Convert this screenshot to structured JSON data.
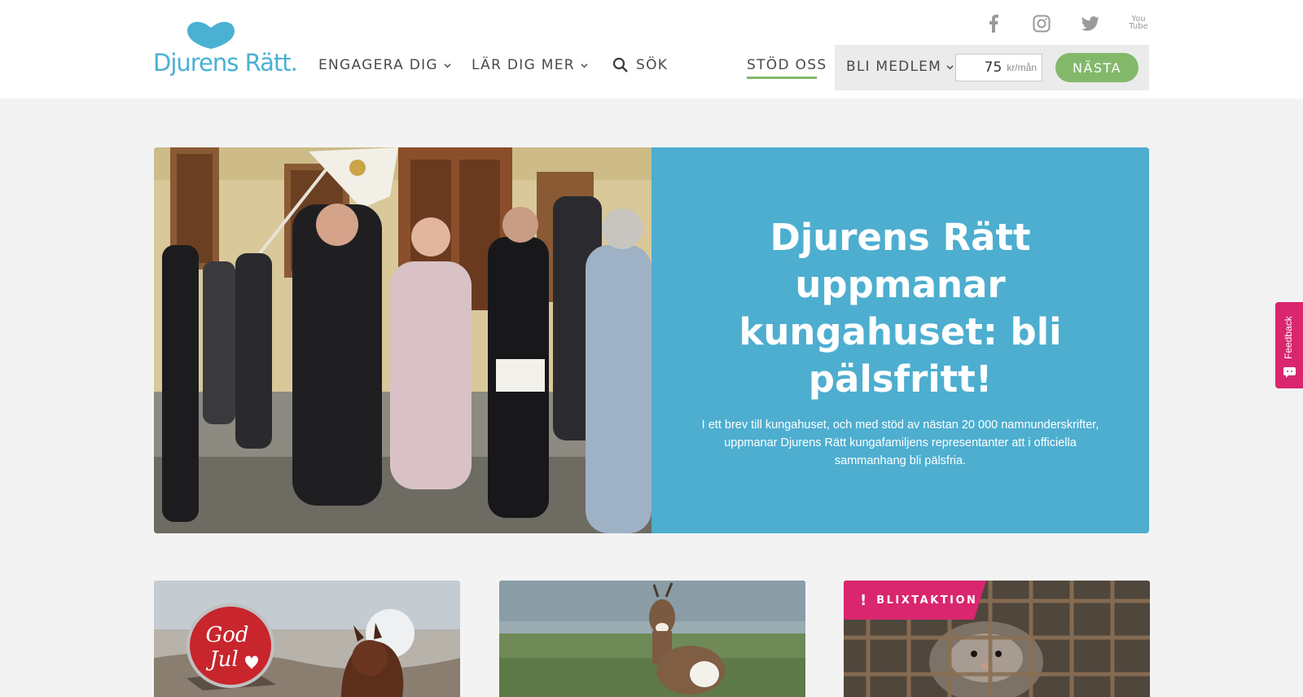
{
  "header": {
    "logo_text": "Djurens Rätt.",
    "nav": {
      "engage_label": "ENGAGERA DIG",
      "learn_label": "LÄR DIG MER",
      "search_label": "SÖK"
    },
    "social": {
      "facebook_icon": "facebook-icon",
      "instagram_icon": "instagram-icon",
      "twitter_icon": "twitter-icon",
      "youtube_line1": "You",
      "youtube_line2": "Tube"
    },
    "support_label": "STÖD OSS",
    "membership": {
      "label": "BLI MEDLEM",
      "amount": "75",
      "unit": "kr/mån",
      "next_label": "NÄSTA"
    }
  },
  "hero": {
    "title": "Djurens Rätt uppmanar kungahuset: bli pälsfritt!",
    "description": "I ett brev till kungahuset, och med stöd av nästan 20 000 namnunderskrifter, uppmanar Djurens Rätt kungafamiljens representanter att i officiella sammanhang bli pälsfria."
  },
  "cards": [
    {
      "sticker_line1": "God",
      "sticker_line2": "Jul"
    },
    {},
    {
      "badge_icon": "!",
      "badge_label": "BLIXTAKTION"
    }
  ],
  "feedback": {
    "label": "Feedback"
  },
  "colors": {
    "brand_blue": "#4ab1d3",
    "hero_panel": "#4daed0",
    "accent_green": "#83b86b",
    "badge_pink": "#d9266e",
    "page_bg": "#f3f3f3"
  }
}
